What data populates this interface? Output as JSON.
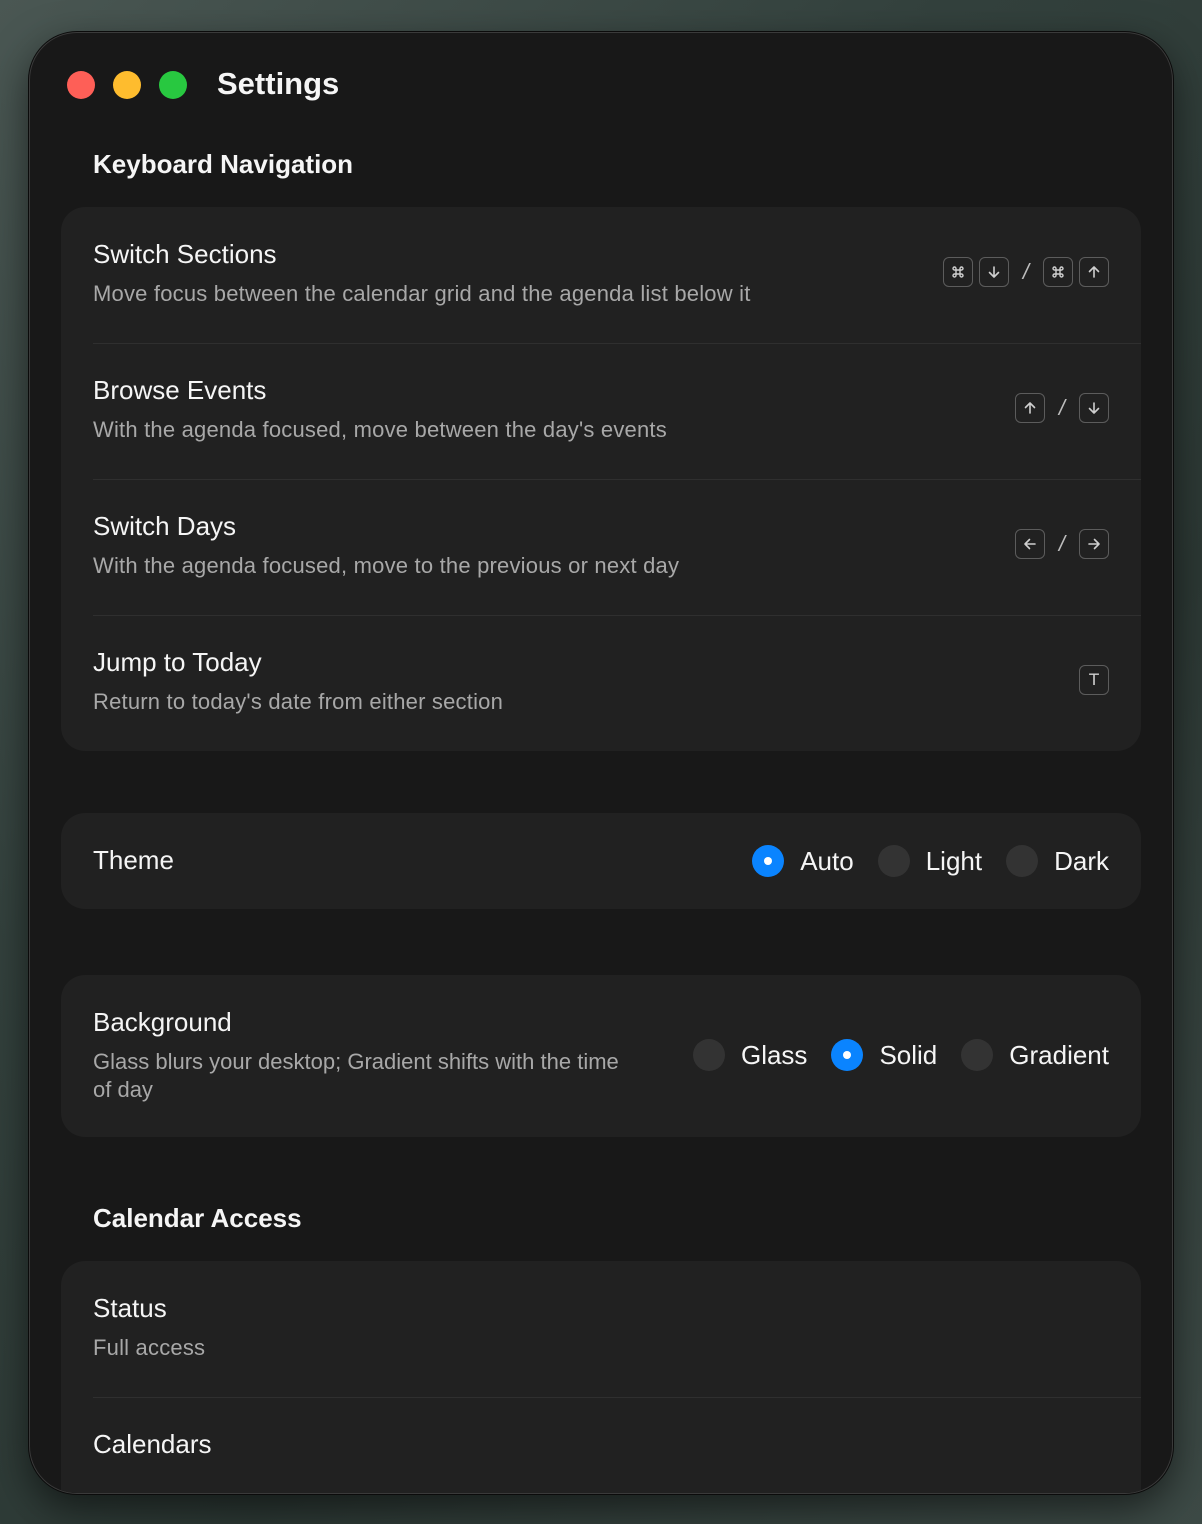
{
  "window": {
    "title": "Settings"
  },
  "keyboard": {
    "heading": "Keyboard Navigation",
    "rows": [
      {
        "title": "Switch Sections",
        "description": "Move focus between the calendar grid and the agenda list below it",
        "shortcut": [
          "command-icon",
          "arrow-down-icon",
          "/",
          "command-icon",
          "arrow-up-icon"
        ]
      },
      {
        "title": "Browse Events",
        "description": "With the agenda focused, move between the day's events",
        "shortcut": [
          "arrow-up-icon",
          "/",
          "arrow-down-icon"
        ]
      },
      {
        "title": "Switch Days",
        "description": "With the agenda focused, move to the previous or next day",
        "shortcut": [
          "arrow-left-icon",
          "/",
          "arrow-right-icon"
        ]
      },
      {
        "title": "Jump to Today",
        "description": "Return to today's date from either section",
        "shortcut": [
          "T"
        ]
      }
    ]
  },
  "theme": {
    "label": "Theme",
    "options": [
      "Auto",
      "Light",
      "Dark"
    ],
    "selected": "Auto"
  },
  "background": {
    "label": "Background",
    "description": "Glass blurs your desktop; Gradient shifts with the time of day",
    "options": [
      "Glass",
      "Solid",
      "Gradient"
    ],
    "selected": "Solid"
  },
  "calendar_access": {
    "heading": "Calendar Access",
    "status_label": "Status",
    "status_value": "Full access",
    "calendars_label": "Calendars"
  },
  "colors": {
    "accent": "#0a84ff",
    "close": "#fe5f57",
    "minimize": "#febc2e",
    "maximize": "#28c840"
  }
}
